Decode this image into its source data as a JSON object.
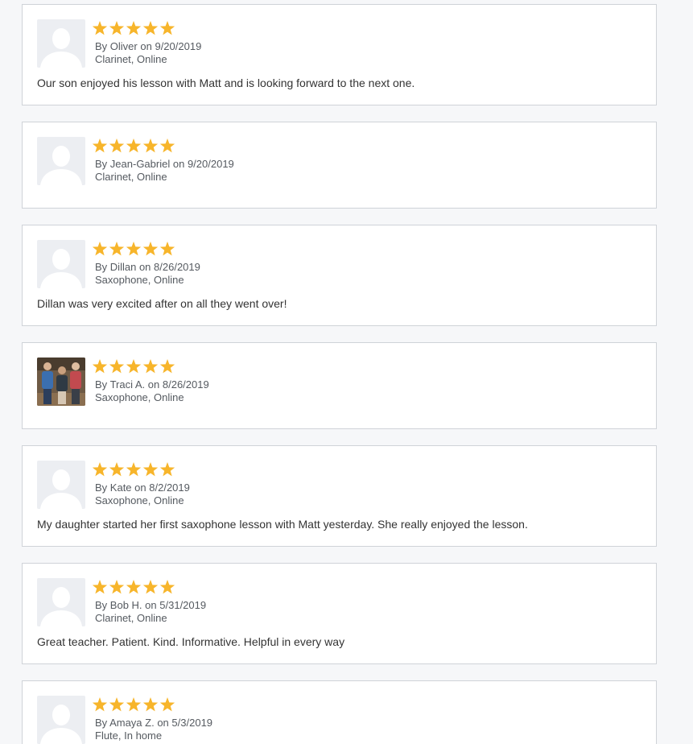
{
  "colors": {
    "star": "#f7b52b",
    "card_border": "#cfd3d8",
    "avatar_bg": "#eceef2",
    "avatar_silhouette": "#ffffff",
    "page_bg": "#f6f7f9"
  },
  "reviews": [
    {
      "rating": 5,
      "by_label": "By",
      "name": "Oliver",
      "on_label": "on",
      "date": "9/20/2019",
      "details": "Clarinet, Online",
      "text": "Our son enjoyed his lesson with Matt and is looking forward to the next one.",
      "avatar": "default-avatar-icon"
    },
    {
      "rating": 5,
      "by_label": "By",
      "name": "Jean-Gabriel",
      "on_label": "on",
      "date": "9/20/2019",
      "details": "Clarinet, Online",
      "text": "",
      "avatar": "default-avatar-icon"
    },
    {
      "rating": 5,
      "by_label": "By",
      "name": "Dillan",
      "on_label": "on",
      "date": "8/26/2019",
      "details": "Saxophone, Online",
      "text": "Dillan was very excited after on all they went over!",
      "avatar": "default-avatar-icon"
    },
    {
      "rating": 5,
      "by_label": "By",
      "name": "Traci A.",
      "on_label": "on",
      "date": "8/26/2019",
      "details": "Saxophone, Online",
      "text": "",
      "avatar": "photo-avatar"
    },
    {
      "rating": 5,
      "by_label": "By",
      "name": "Kate",
      "on_label": "on",
      "date": "8/2/2019",
      "details": "Saxophone, Online",
      "text": "My daughter started her first saxophone lesson with Matt yesterday. She really enjoyed the lesson.",
      "avatar": "default-avatar-icon"
    },
    {
      "rating": 5,
      "by_label": "By",
      "name": "Bob H.",
      "on_label": "on",
      "date": "5/31/2019",
      "details": "Clarinet, Online",
      "text": "Great teacher. Patient. Kind. Informative. Helpful in every way",
      "avatar": "default-avatar-icon"
    },
    {
      "rating": 5,
      "by_label": "By",
      "name": "Amaya Z.",
      "on_label": "on",
      "date": "5/3/2019",
      "details": "Flute, In home",
      "text": "",
      "avatar": "default-avatar-icon"
    }
  ]
}
